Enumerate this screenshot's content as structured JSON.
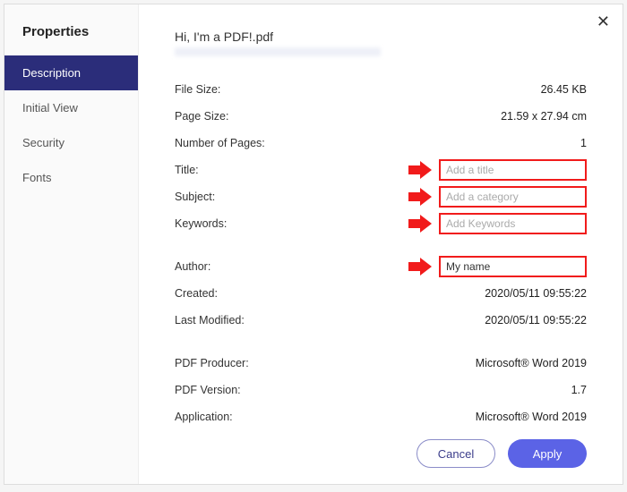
{
  "title": "Properties",
  "sidebar": {
    "items": [
      {
        "label": "Description",
        "active": true
      },
      {
        "label": "Initial View",
        "active": false
      },
      {
        "label": "Security",
        "active": false
      },
      {
        "label": "Fonts",
        "active": false
      }
    ]
  },
  "header": {
    "filename": "Hi, I'm a PDF!.pdf"
  },
  "fields": {
    "file_size": {
      "label": "File Size:",
      "value": "26.45 KB"
    },
    "page_size": {
      "label": "Page Size:",
      "value": "21.59 x 27.94 cm"
    },
    "pages": {
      "label": "Number of Pages:",
      "value": "1"
    },
    "title": {
      "label": "Title:",
      "placeholder": "Add a title",
      "value": ""
    },
    "subject": {
      "label": "Subject:",
      "placeholder": "Add a category",
      "value": ""
    },
    "keywords": {
      "label": "Keywords:",
      "placeholder": "Add Keywords",
      "value": ""
    },
    "author": {
      "label": "Author:",
      "placeholder": "",
      "value": "My name"
    },
    "created": {
      "label": "Created:",
      "value": "2020/05/11 09:55:22"
    },
    "modified": {
      "label": "Last Modified:",
      "value": "2020/05/11 09:55:22"
    },
    "producer": {
      "label": "PDF Producer:",
      "value": "Microsoft® Word 2019"
    },
    "version": {
      "label": "PDF Version:",
      "value": "1.7"
    },
    "application": {
      "label": "Application:",
      "value": "Microsoft® Word 2019"
    }
  },
  "footer": {
    "cancel": "Cancel",
    "apply": "Apply"
  }
}
